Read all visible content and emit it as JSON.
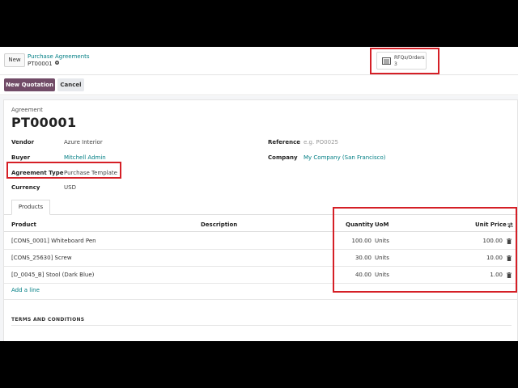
{
  "control_panel": {
    "new_label": "New",
    "breadcrumb_parent": "Purchase Agreements",
    "breadcrumb_current": "PT00001",
    "smart_button": {
      "label": "RFQs/Orders",
      "count": "3"
    }
  },
  "status_bar": {
    "primary_label": "New Quotation",
    "secondary_label": "Cancel"
  },
  "form": {
    "sublabel": "Agreement",
    "title": "PT00001",
    "left_fields": {
      "vendor": {
        "label": "Vendor",
        "value": "Azure Interior"
      },
      "buyer": {
        "label": "Buyer",
        "value": "Mitchell Admin"
      },
      "agreement_type": {
        "label": "Agreement Type",
        "value": "Purchase Template"
      },
      "currency": {
        "label": "Currency",
        "value": "USD"
      }
    },
    "right_fields": {
      "reference": {
        "label": "Reference",
        "placeholder": "e.g. PO0025"
      },
      "company": {
        "label": "Company",
        "value": "My Company (San Francisco)"
      }
    },
    "tab_label": "Products",
    "table": {
      "headers": {
        "product": "Product",
        "description": "Description",
        "quantity": "Quantity",
        "uom": "UoM",
        "unit_price": "Unit Price"
      },
      "rows": [
        {
          "product": "[CONS_0001] Whiteboard Pen",
          "description": "",
          "quantity": "100.00",
          "uom": "Units",
          "unit_price": "100.00"
        },
        {
          "product": "[CONS_25630] Screw",
          "description": "",
          "quantity": "30.00",
          "uom": "Units",
          "unit_price": "10.00"
        },
        {
          "product": "[D_0045_B] Stool (Dark Blue)",
          "description": "",
          "quantity": "40.00",
          "uom": "Units",
          "unit_price": "1.00"
        }
      ],
      "add_line_label": "Add a line"
    },
    "terms_heading": "TERMS AND CONDITIONS"
  },
  "colors": {
    "accent": "#714b67",
    "link": "#017e84",
    "annotation": "#d51f26"
  }
}
